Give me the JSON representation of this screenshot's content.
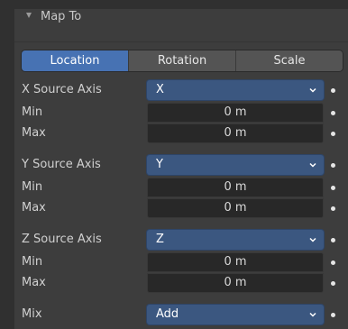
{
  "header": {
    "title": "Map To",
    "icon": "disclosure-triangle-down"
  },
  "tabs": [
    {
      "label": "Location",
      "active": true
    },
    {
      "label": "Rotation",
      "active": false
    },
    {
      "label": "Scale",
      "active": false
    }
  ],
  "rows": {
    "x_axis": {
      "label": "X Source Axis",
      "value": "X"
    },
    "x_min": {
      "label": "Min",
      "value": "0 m"
    },
    "x_max": {
      "label": "Max",
      "value": "0 m"
    },
    "y_axis": {
      "label": "Y Source Axis",
      "value": "Y"
    },
    "y_min": {
      "label": "Min",
      "value": "0 m"
    },
    "y_max": {
      "label": "Max",
      "value": "0 m"
    },
    "z_axis": {
      "label": "Z Source Axis",
      "value": "Z"
    },
    "z_min": {
      "label": "Min",
      "value": "0 m"
    },
    "z_max": {
      "label": "Max",
      "value": "0 m"
    },
    "mix": {
      "label": "Mix",
      "value": "Add"
    }
  },
  "colors": {
    "panel": "#3d3d3d",
    "active_tab": "#4772b3",
    "dropdown": "#3b5780",
    "field": "#282828"
  }
}
